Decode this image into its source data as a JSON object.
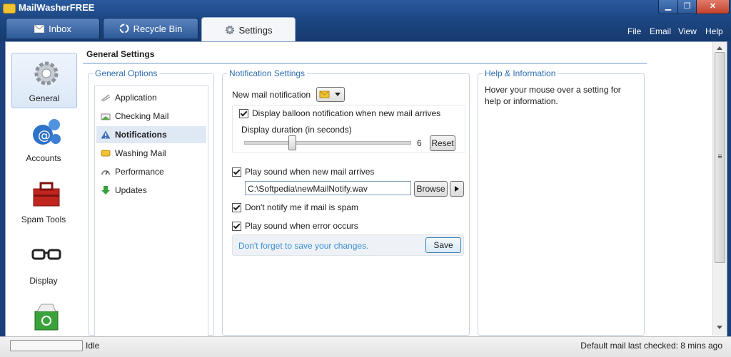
{
  "app": {
    "title_main": "MailWasher",
    "title_suffix": "FREE"
  },
  "window_controls": {
    "minimize": "▁",
    "maximize": "❐",
    "close": "✕"
  },
  "tabs": [
    {
      "label": "Inbox",
      "icon": "envelope-icon"
    },
    {
      "label": "Recycle Bin",
      "icon": "recycle-icon"
    },
    {
      "label": "Settings",
      "icon": "gear-icon"
    }
  ],
  "menu": [
    "File",
    "Email",
    "View",
    "Help"
  ],
  "sidebar": [
    {
      "label": "General",
      "icon": "gears-icon",
      "selected": true
    },
    {
      "label": "Accounts",
      "icon": "accounts-icon"
    },
    {
      "label": "Spam Tools",
      "icon": "toolbox-icon"
    },
    {
      "label": "Display",
      "icon": "glasses-icon"
    },
    {
      "label": "",
      "icon": "recycle-bin-icon"
    }
  ],
  "page_title": "General Settings",
  "general_options": {
    "legend": "General Options",
    "items": [
      {
        "label": "Application",
        "icon": "application-icon"
      },
      {
        "label": "Checking Mail",
        "icon": "checking-mail-icon"
      },
      {
        "label": "Notifications",
        "icon": "warning-icon",
        "selected": true
      },
      {
        "label": "Washing Mail",
        "icon": "washing-mail-icon"
      },
      {
        "label": "Performance",
        "icon": "performance-icon"
      },
      {
        "label": "Updates",
        "icon": "down-arrow-icon"
      }
    ]
  },
  "notification_settings": {
    "legend": "Notification Settings",
    "new_mail_label": "New mail notification",
    "balloon_label": "Display balloon notification when new mail arrives",
    "balloon_checked": true,
    "duration_label": "Display duration (in seconds)",
    "duration_value": "6",
    "duration_slider": 0.29,
    "reset_label": "Reset",
    "play_sound_label": "Play sound when new mail arrives",
    "play_sound_checked": true,
    "sound_file": "C:\\Softpedia\\newMailNotify.wav",
    "browse_label": "Browse",
    "dont_notify_label": "Don't notify me if mail is spam",
    "dont_notify_checked": true,
    "error_sound_label": "Play sound when error occurs",
    "error_sound_checked": true,
    "save_hint": "Don't forget to save your changes.",
    "save_label": "Save"
  },
  "help_info": {
    "legend": "Help & Information",
    "text": "Hover your mouse over a setting for help or information."
  },
  "status": {
    "state": "Idle",
    "last_checked": "Default mail last checked: 8 mins ago"
  },
  "colors": {
    "accent": "#2e6db0",
    "titlebar": "#1d4783"
  }
}
